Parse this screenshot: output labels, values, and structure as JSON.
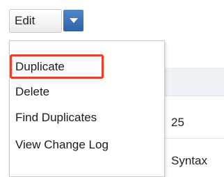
{
  "toolbar": {
    "edit_label": "Edit",
    "caret_icon": "chevron-down-icon"
  },
  "menu": {
    "items": [
      {
        "label": "Duplicate",
        "highlighted": true
      },
      {
        "label": "Delete"
      },
      {
        "label": "Find Duplicates"
      },
      {
        "label": "View Change Log"
      }
    ]
  },
  "background": {
    "cells": [
      "25",
      "Syntax"
    ]
  },
  "colors": {
    "accent": "#2f63a8",
    "highlight": "#e8402a"
  }
}
